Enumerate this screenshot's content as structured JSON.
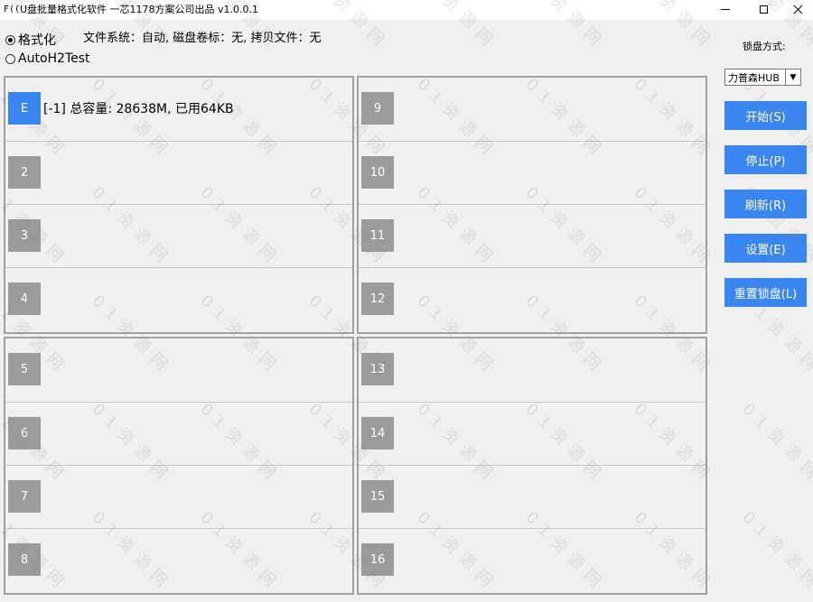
{
  "window": {
    "icon_text": "F((",
    "title": "U盘批量格式化软件  一芯1178方案公司出品 v1.0.0.1"
  },
  "options": {
    "format_label": "格式化",
    "h2test_label": "AutoH2Test",
    "fs_info": "文件系统：自动, 磁盘卷标：无, 拷贝文件：无"
  },
  "panel": {
    "lock_label": "锁盘方式:",
    "lock_value": "力普森HUB",
    "buttons": [
      "开始(S)",
      "停止(P)",
      "刷新(R)",
      "设置(E)",
      "重置锁盘(L)"
    ]
  },
  "groups": [
    {
      "slots": [
        {
          "label": "E",
          "info": "[-1] 总容量: 28638M, 已用64KB",
          "active": true
        },
        {
          "label": "2"
        },
        {
          "label": "3"
        },
        {
          "label": "4"
        }
      ]
    },
    {
      "slots": [
        {
          "label": "9"
        },
        {
          "label": "10"
        },
        {
          "label": "11"
        },
        {
          "label": "12"
        }
      ]
    },
    {
      "slots": [
        {
          "label": "5"
        },
        {
          "label": "6"
        },
        {
          "label": "7"
        },
        {
          "label": "8"
        }
      ]
    },
    {
      "slots": [
        {
          "label": "13"
        },
        {
          "label": "14"
        },
        {
          "label": "15"
        },
        {
          "label": "16"
        }
      ]
    }
  ],
  "watermark_text": "01资源网"
}
